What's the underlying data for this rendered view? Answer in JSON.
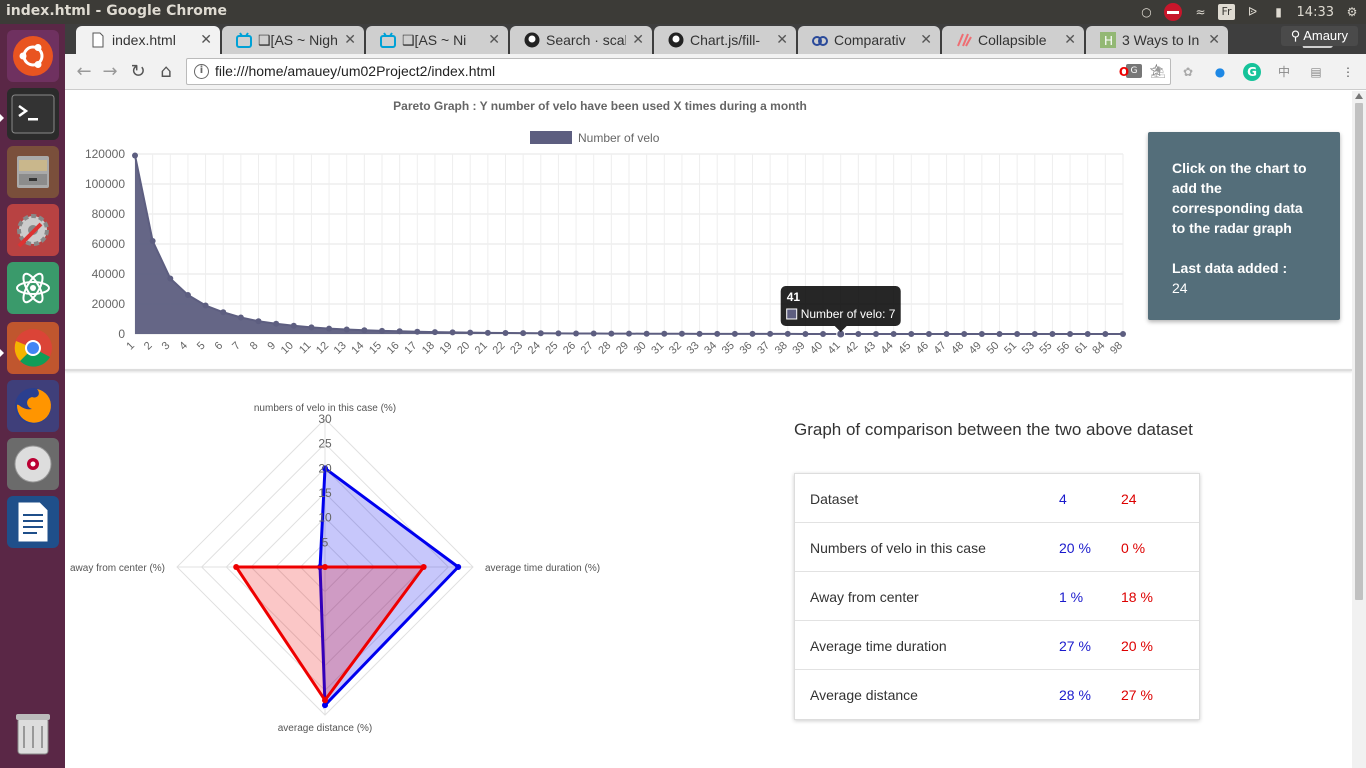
{
  "window": {
    "title": "index.html - Google Chrome"
  },
  "system": {
    "keyboard": "Fr",
    "clock": "14:33"
  },
  "browser": {
    "tabs": [
      {
        "label": "index.html",
        "icon": "document-icon",
        "active": true
      },
      {
        "label": "❑[AS ~ Nigh",
        "icon": "bilibili-icon"
      },
      {
        "label": "❑[AS ~ Ni",
        "icon": "bilibili-icon"
      },
      {
        "label": "Search · scal",
        "icon": "github-icon"
      },
      {
        "label": "Chart.js/fill-",
        "icon": "github-icon"
      },
      {
        "label": "Comparativ",
        "icon": "chartjs-icon"
      },
      {
        "label": "Collapsible",
        "icon": "materialize-icon"
      },
      {
        "label": "3 Ways to In",
        "icon": "wikihow-icon"
      }
    ],
    "profile": "Amaury",
    "url": "file:///home/amauey/um02Project2/index.html"
  },
  "info_panel": {
    "instruction": "Click on the chart to add the corresponding data to the radar graph",
    "last_label": "Last data added :",
    "last_value": "24"
  },
  "tooltip": {
    "title": "41",
    "label": "Number of velo: 7"
  },
  "comparison": {
    "title": "Graph of comparison between the two above dataset",
    "rows": [
      {
        "label": "Dataset",
        "a": "4",
        "b": "24"
      },
      {
        "label": "Numbers of velo in this case",
        "a": "20 %",
        "b": "0 %"
      },
      {
        "label": "Away from center",
        "a": "1 %",
        "b": "18 %"
      },
      {
        "label": "Average time duration",
        "a": "27 %",
        "b": "20 %"
      },
      {
        "label": "Average distance",
        "a": "28 %",
        "b": "27 %"
      }
    ]
  },
  "colors": {
    "area": "#5d5e80",
    "radar_a": "#0000ee",
    "radar_b": "#ee0000",
    "panel": "#546e7a"
  },
  "chart_data": [
    {
      "type": "area",
      "title": "Pareto Graph : Y number of velo have been used X times during a month",
      "legend": "Number of velo",
      "categories": [
        "1",
        "2",
        "3",
        "4",
        "5",
        "6",
        "7",
        "8",
        "9",
        "10",
        "11",
        "12",
        "13",
        "14",
        "15",
        "16",
        "17",
        "18",
        "19",
        "20",
        "21",
        "22",
        "23",
        "24",
        "25",
        "26",
        "27",
        "28",
        "29",
        "30",
        "31",
        "32",
        "33",
        "34",
        "35",
        "36",
        "37",
        "38",
        "39",
        "40",
        "41",
        "42",
        "43",
        "44",
        "45",
        "46",
        "47",
        "48",
        "49",
        "50",
        "51",
        "53",
        "55",
        "56",
        "61",
        "84",
        "98"
      ],
      "values": [
        119000,
        62000,
        37000,
        26000,
        19000,
        14500,
        11000,
        8500,
        6800,
        5500,
        4400,
        3600,
        3000,
        2500,
        2100,
        1800,
        1500,
        1250,
        1050,
        900,
        780,
        660,
        560,
        480,
        410,
        350,
        300,
        260,
        220,
        190,
        165,
        140,
        120,
        100,
        85,
        70,
        58,
        48,
        38,
        28,
        7,
        6,
        5,
        4,
        4,
        3,
        3,
        3,
        2,
        2,
        2,
        2,
        1,
        1,
        1,
        1,
        1
      ],
      "ylim": [
        0,
        120000
      ],
      "y_ticks": [
        0,
        20000,
        40000,
        60000,
        80000,
        100000,
        120000
      ]
    },
    {
      "type": "radar",
      "axes": [
        "numbers of velo in this case (%)",
        "average time duration (%)",
        "average distance (%)",
        "away from center (%)"
      ],
      "r_ticks": [
        5,
        10,
        15,
        20,
        25,
        30
      ],
      "rlim": [
        0,
        30
      ],
      "series": [
        {
          "values": [
            20,
            27,
            28,
            1
          ],
          "color": "#0000ee"
        },
        {
          "values": [
            0,
            20,
            27,
            18
          ],
          "color": "#ee0000"
        }
      ]
    }
  ]
}
